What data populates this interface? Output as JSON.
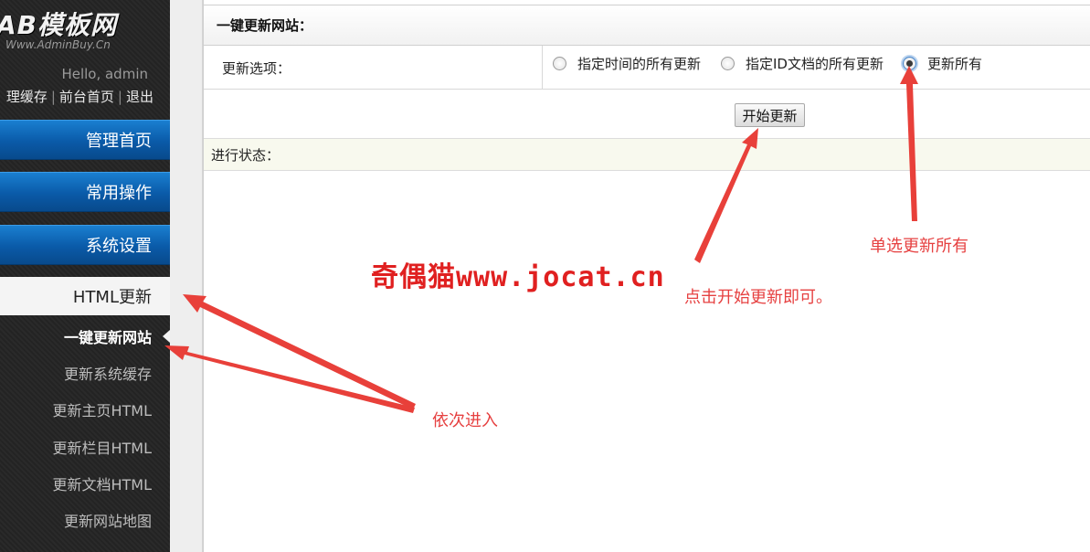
{
  "sidebar": {
    "logo_main": "AB模板网",
    "logo_sub": "Www.AdminBuy.Cn",
    "hello": "Hello, admin",
    "links": [
      "理缓存",
      "前台首页",
      "退出"
    ],
    "link_separator": "|",
    "menus": [
      "管理首页",
      "常用操作",
      "系统设置"
    ],
    "section": "HTML更新",
    "sub_items": [
      {
        "label": "一键更新网站",
        "active": true
      },
      {
        "label": "更新系统缓存",
        "active": false
      },
      {
        "label": "更新主页HTML",
        "active": false
      },
      {
        "label": "更新栏目HTML",
        "active": false
      },
      {
        "label": "更新文档HTML",
        "active": false
      },
      {
        "label": "更新网站地图",
        "active": false
      }
    ]
  },
  "panel": {
    "title": "一键更新网站：",
    "options_label": "更新选项：",
    "radio_options": [
      {
        "label": "指定时间的所有更新",
        "checked": false
      },
      {
        "label": "指定ID文档的所有更新",
        "checked": false
      },
      {
        "label": "更新所有",
        "checked": true
      }
    ],
    "start_button": "开始更新",
    "status_label": "进行状态："
  },
  "annotations": {
    "single_select": "单选更新所有",
    "click_start": "点击开始更新即可。",
    "enter_sequence": "依次进入",
    "watermark": "奇偶猫www.jocat.cn",
    "color": "#e64040"
  },
  "colors": {
    "menu_blue": "#0a5aa8",
    "sidebar_bg": "#262626",
    "status_bg": "#f8f9ee"
  }
}
